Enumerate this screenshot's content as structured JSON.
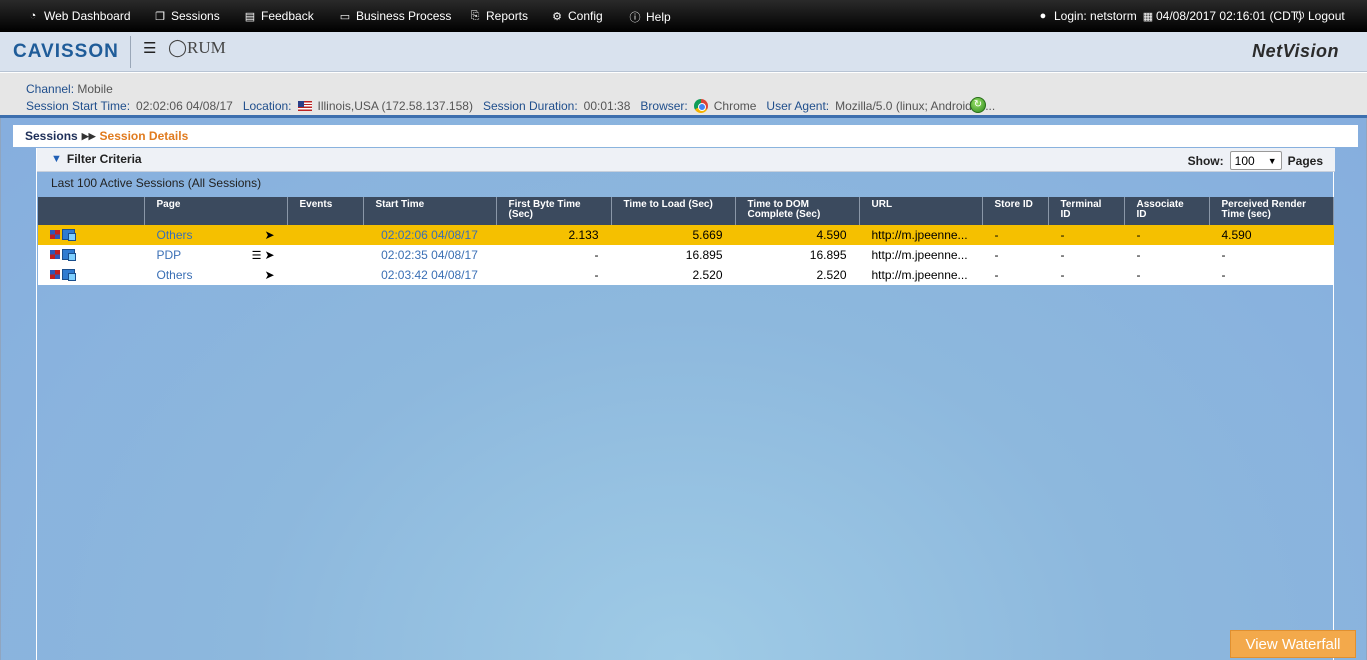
{
  "nav": {
    "items": [
      {
        "label": "Web Dashboard",
        "icon": "dashboard-icon"
      },
      {
        "label": "Sessions",
        "icon": "sessions-icon"
      },
      {
        "label": "Feedback",
        "icon": "feedback-icon"
      },
      {
        "label": "Business Process",
        "icon": "business-process-icon"
      },
      {
        "label": "Reports",
        "icon": "reports-icon"
      },
      {
        "label": "Config",
        "icon": "config-icon"
      },
      {
        "label": "Help",
        "icon": "help-icon"
      }
    ],
    "login": "Login: netstorm",
    "datetime": "04/08/2017 02:16:01 (CDT)",
    "logout": "Logout"
  },
  "brand": {
    "logo": "CAVISSON",
    "product": "RUM",
    "app_name": "NetVision"
  },
  "info": {
    "channel_label": "Channel:",
    "channel_value": "Mobile",
    "start_label": "Session Start Time:",
    "start_value": "02:02:06 04/08/17",
    "location_label": "Location:",
    "location_value": "Illinois,USA (172.58.137.158)",
    "duration_label": "Session Duration:",
    "duration_value": "00:01:38",
    "browser_label": "Browser:",
    "browser_value": "Chrome",
    "agent_label": "User Agent:",
    "agent_value": "Mozilla/5.0 (linux; Android 6...."
  },
  "breadcrumb": {
    "home": "Sessions",
    "current": "Session Details"
  },
  "filter": {
    "title": "Filter Criteria",
    "show_label": "Show:",
    "show_value": "100",
    "pages_label": "Pages",
    "sessions_count": "Last 100 Active Sessions (All Sessions)"
  },
  "table": {
    "headers": [
      "",
      "Page",
      "Events",
      "Start Time",
      "First Byte Time (Sec)",
      "Time to Load (Sec)",
      "Time to DOM Complete (Sec)",
      "URL",
      "Store ID",
      "Terminal ID",
      "Associate ID",
      "Perceived Render Time (sec)"
    ],
    "rows": [
      {
        "page": "Others",
        "start": "02:02:06 04/08/17",
        "first_byte": "2.133",
        "load": "5.669",
        "dom": "4.590",
        "url": "http://m.jpeenne...",
        "store": "-",
        "terminal": "-",
        "associate": "-",
        "render": "4.590"
      },
      {
        "page": "PDP",
        "start": "02:02:35 04/08/17",
        "first_byte": "-",
        "load": "16.895",
        "dom": "16.895",
        "url": "http://m.jpeenne...",
        "store": "-",
        "terminal": "-",
        "associate": "-",
        "render": "-"
      },
      {
        "page": "Others",
        "start": "02:03:42 04/08/17",
        "first_byte": "-",
        "load": "2.520",
        "dom": "2.520",
        "url": "http://m.jpeenne...",
        "store": "-",
        "terminal": "-",
        "associate": "-",
        "render": "-"
      }
    ]
  },
  "actions": {
    "waterfall": "View Waterfall"
  }
}
